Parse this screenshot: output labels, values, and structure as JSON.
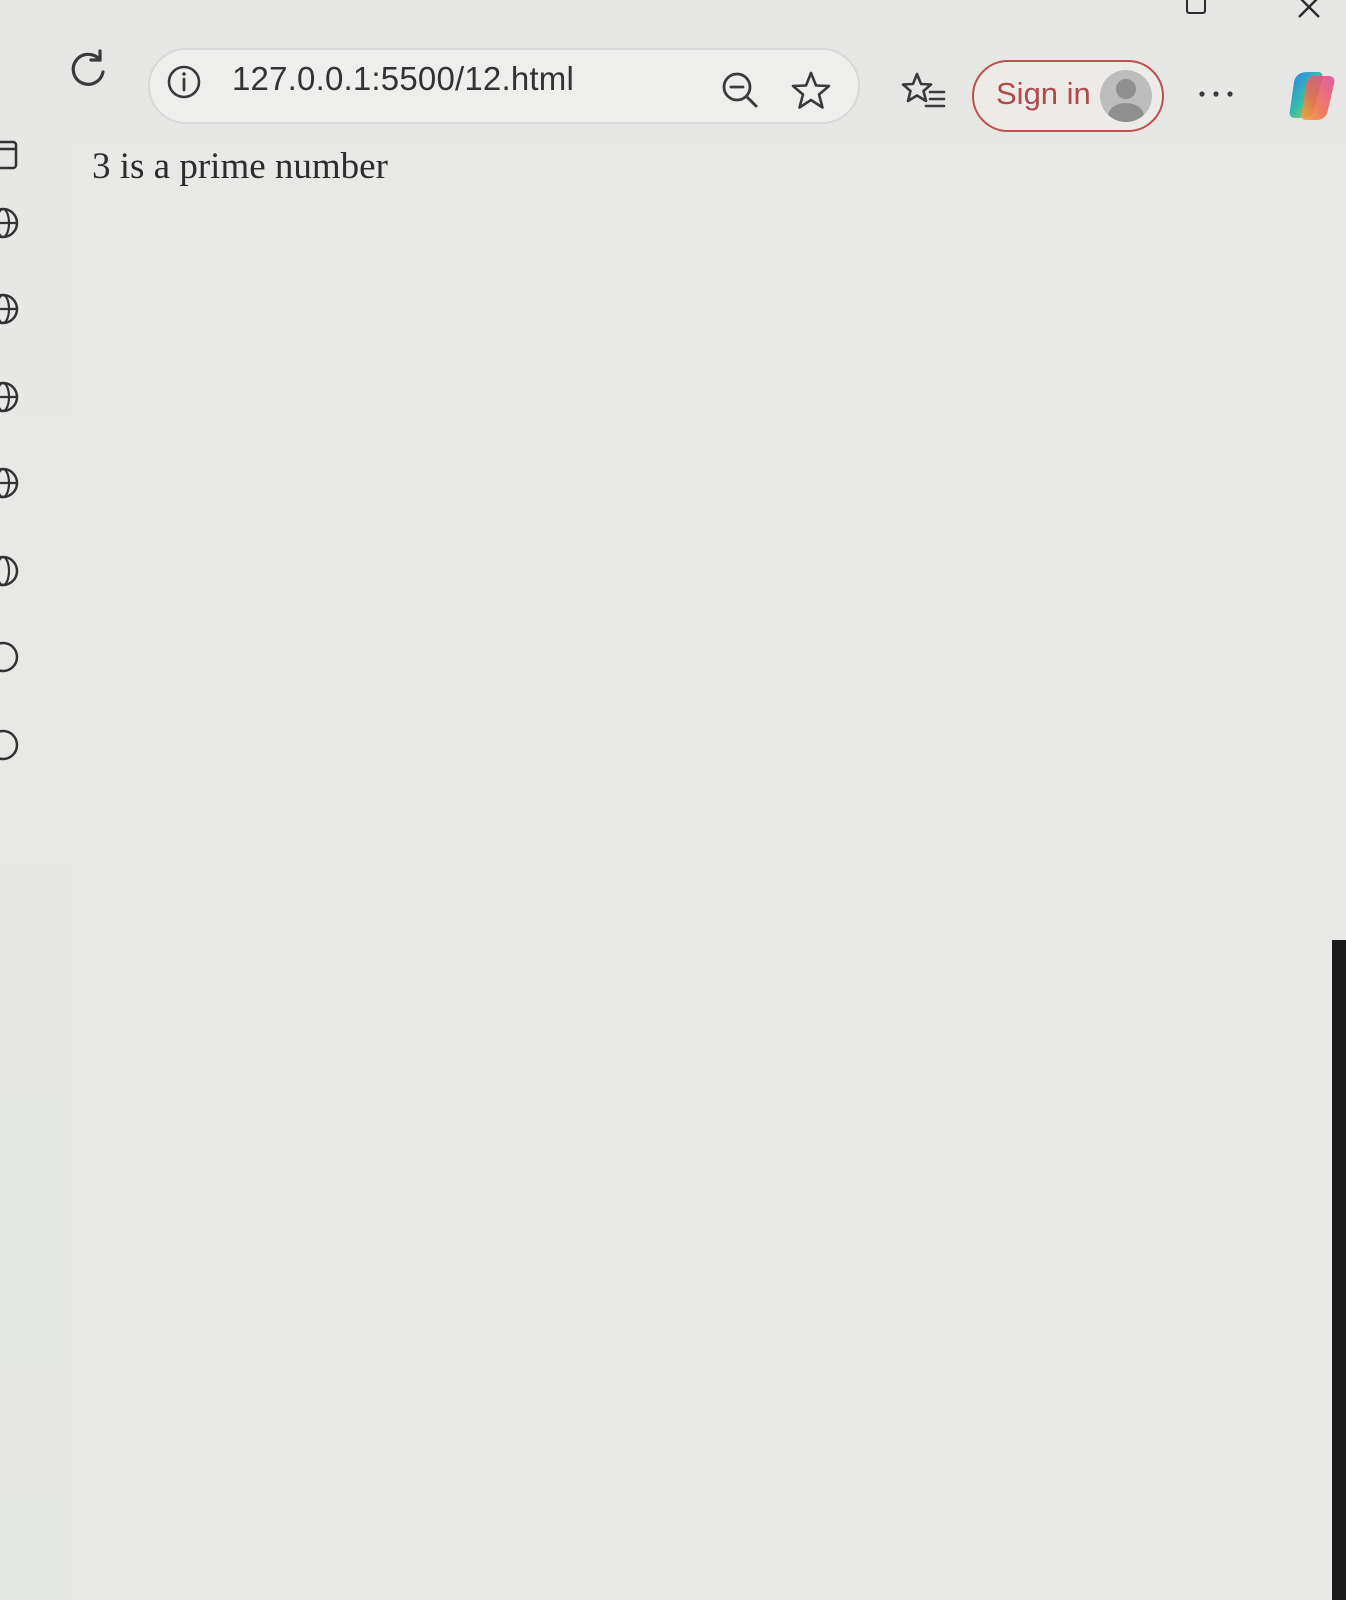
{
  "browser": {
    "url": "127.0.0.1:5500/12.html",
    "signin_label": "Sign in",
    "accent_color": "#c0504d"
  },
  "icons": {
    "reload": "reload-icon",
    "info": "info-icon",
    "zoom": "zoom-out-icon",
    "favorite": "star-icon",
    "favorites_list": "favorites-icon",
    "avatar": "avatar-icon",
    "more": "more-icon",
    "copilot": "copilot-icon"
  },
  "page": {
    "text": "3 is a prime number"
  }
}
